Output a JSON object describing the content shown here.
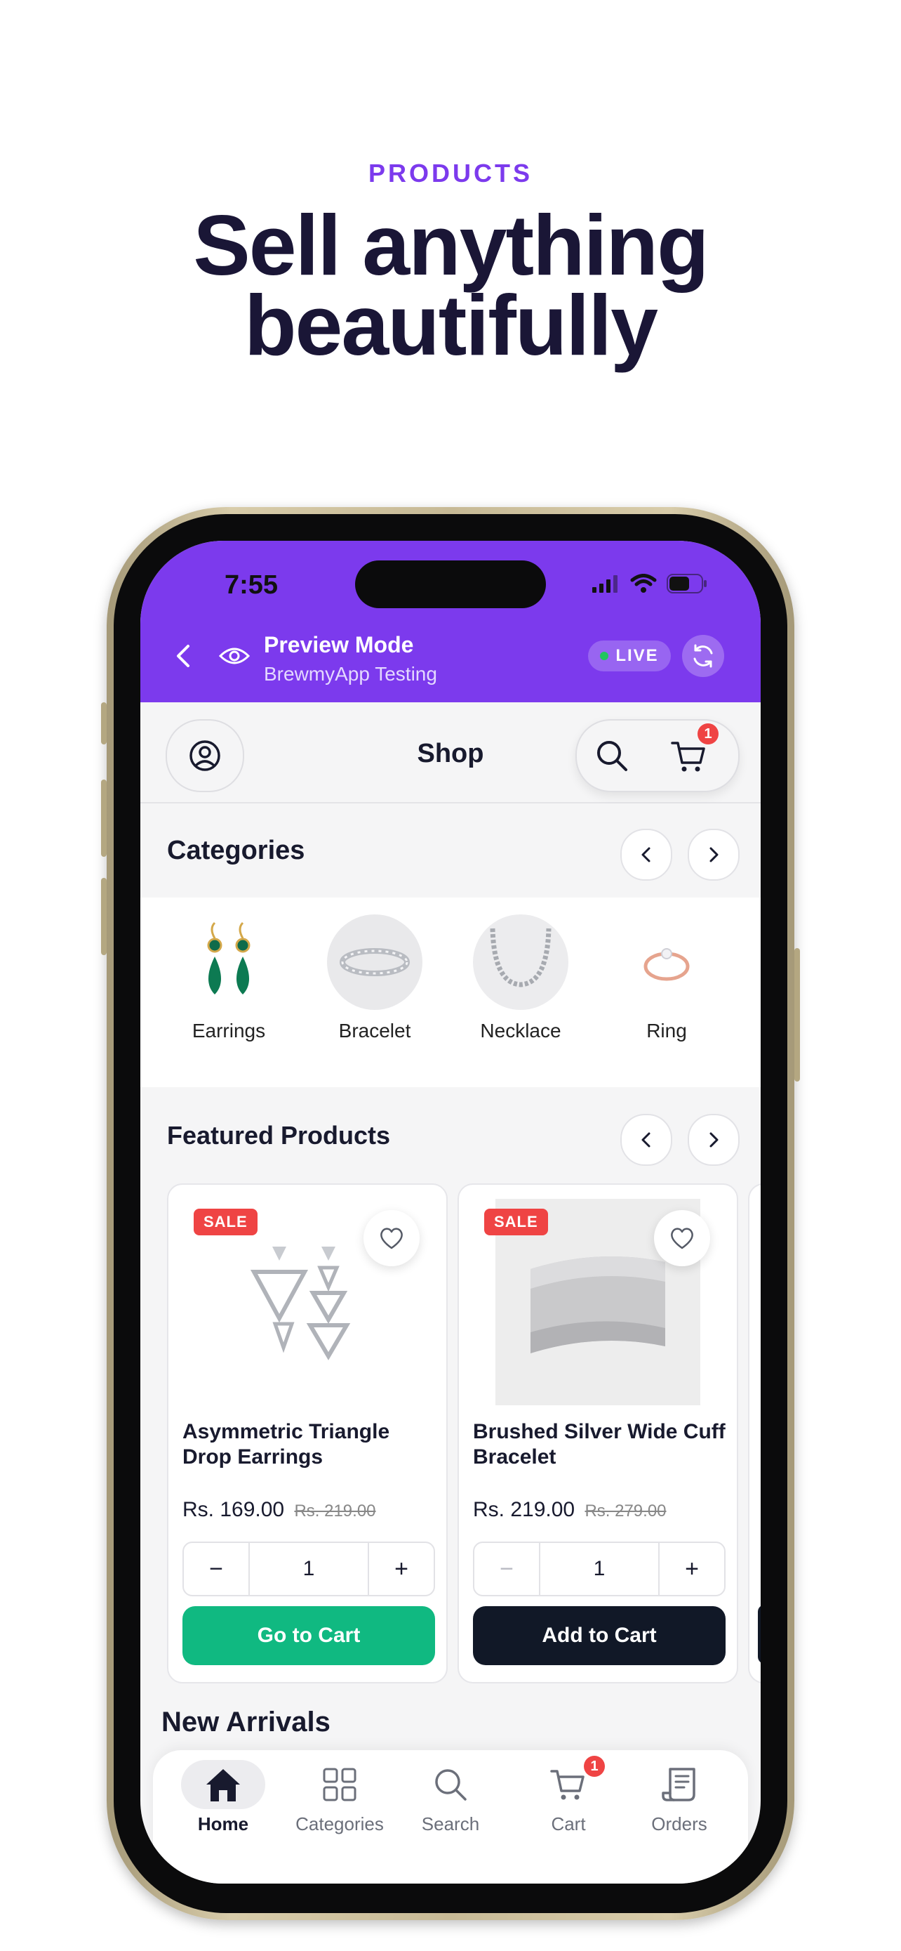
{
  "promo": {
    "eyebrow": "PRODUCTS",
    "headline_line1": "Sell anything",
    "headline_line2": "beautifully"
  },
  "status_bar": {
    "time": "7:55"
  },
  "preview_bar": {
    "title": "Preview Mode",
    "subtitle": "BrewmyApp Testing",
    "live_label": "LIVE"
  },
  "header": {
    "title": "Shop",
    "cart_count": "1"
  },
  "categories": {
    "title": "Categories",
    "items": [
      {
        "label": "Earrings"
      },
      {
        "label": "Bracelet"
      },
      {
        "label": "Necklace"
      },
      {
        "label": "Ring"
      }
    ]
  },
  "featured": {
    "title": "Featured Products",
    "products": [
      {
        "badge": "SALE",
        "name": "Asymmetric Triangle Drop Earrings",
        "price": "Rs. 169.00",
        "old_price": "Rs. 219.00",
        "quantity": "1",
        "cta": "Go to Cart"
      },
      {
        "badge": "SALE",
        "name": "Brushed Silver Wide Cuff Bracelet",
        "price": "Rs. 219.00",
        "old_price": "Rs. 279.00",
        "quantity": "1",
        "cta": "Add to Cart"
      }
    ]
  },
  "new_arrivals": {
    "title": "New Arrivals"
  },
  "tabs": [
    {
      "label": "Home",
      "icon": "home-icon"
    },
    {
      "label": "Categories",
      "icon": "grid-icon"
    },
    {
      "label": "Search",
      "icon": "search-icon"
    },
    {
      "label": "Cart",
      "icon": "cart-icon"
    },
    {
      "label": "Orders",
      "icon": "receipt-icon"
    }
  ],
  "colors": {
    "brand": "#7c3aed",
    "sale": "#ef4444",
    "go_to_cart": "#10b981",
    "add_to_cart": "#111827"
  }
}
